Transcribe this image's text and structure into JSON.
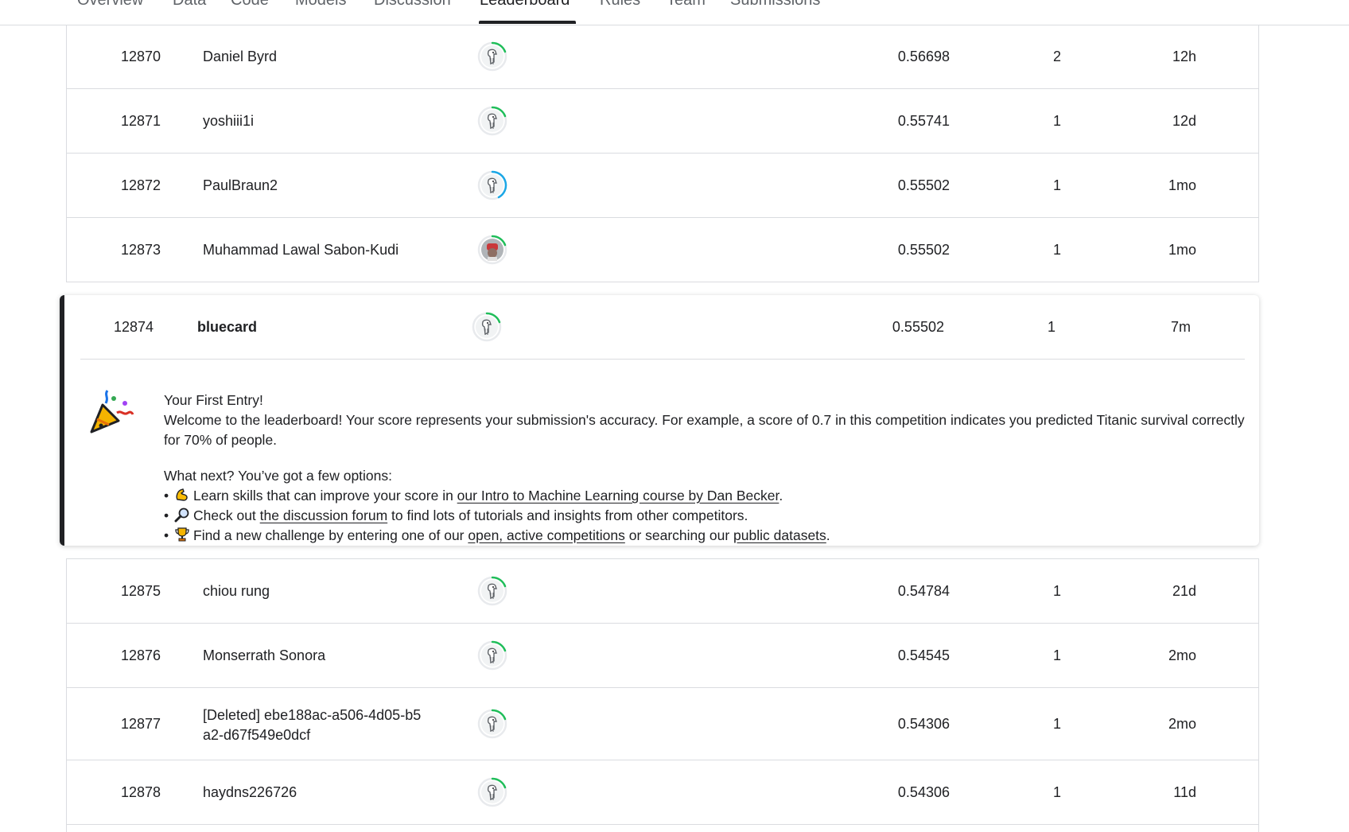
{
  "tabs": [
    {
      "label": "Overview"
    },
    {
      "label": "Data"
    },
    {
      "label": "Code"
    },
    {
      "label": "Models"
    },
    {
      "label": "Discussion"
    },
    {
      "label": "Leaderboard",
      "active": true
    },
    {
      "label": "Rules"
    },
    {
      "label": "Team"
    },
    {
      "label": "Submissions"
    }
  ],
  "rows_top": [
    {
      "rank": "12870",
      "name": "Daniel Byrd",
      "score": "0.56698",
      "entries": "2",
      "last": "12h",
      "tier_color": "#20be5a"
    },
    {
      "rank": "12871",
      "name": "yoshiii1i",
      "score": "0.55741",
      "entries": "1",
      "last": "12d",
      "tier_color": "#20be5a"
    },
    {
      "rank": "12872",
      "name": "PaulBraun2",
      "score": "0.55502",
      "entries": "1",
      "last": "1mo",
      "tier_color": "#1ba7e6"
    },
    {
      "rank": "12873",
      "name": "Muhammad Lawal Sabon-Kudi",
      "score": "0.55502",
      "entries": "1",
      "last": "1mo",
      "tier_color": "#20be5a"
    }
  ],
  "current_user": {
    "rank": "12874",
    "name": "bluecard",
    "score": "0.55502",
    "entries": "1",
    "last": "7m",
    "tier_color": "#20be5a"
  },
  "first_entry": {
    "title": "Your First Entry!",
    "welcome": "Welcome to the leaderboard! Your score represents your submission's accuracy. For example, a score of 0.7 in this competition indicates you predicted Titanic survival correctly for 70% of people.",
    "next": "What next? You’ve got a few options:",
    "b1_pre": "Learn skills that can improve your score in ",
    "b1_link": "our Intro to Machine Learning course by Dan Becker",
    "b1_post": ".",
    "b2_pre": "Check out ",
    "b2_link": "the discussion forum",
    "b2_post": " to find lots of tutorials and insights from other competitors.",
    "b3_pre": "Find a new challenge by entering one of our ",
    "b3_link": "open, active competitions",
    "b3_mid": " or searching our ",
    "b3_link2": "public datasets",
    "b3_post": "."
  },
  "rows_bottom": [
    {
      "rank": "12875",
      "name": "chiou rung",
      "score": "0.54784",
      "entries": "1",
      "last": "21d",
      "tier_color": "#20be5a"
    },
    {
      "rank": "12876",
      "name": "Monserrath Sonora",
      "score": "0.54545",
      "entries": "1",
      "last": "2mo",
      "tier_color": "#20be5a"
    },
    {
      "rank": "12877",
      "name_line1": "[Deleted] ebe188ac-a506-4d05-b5",
      "name_line2": "a2-d67f549e0dcf",
      "score": "0.54306",
      "entries": "1",
      "last": "2mo",
      "tier_color": "#20be5a"
    },
    {
      "rank": "12878",
      "name": "haydns226726",
      "score": "0.54306",
      "entries": "1",
      "last": "11d",
      "tier_color": "#20be5a"
    }
  ]
}
